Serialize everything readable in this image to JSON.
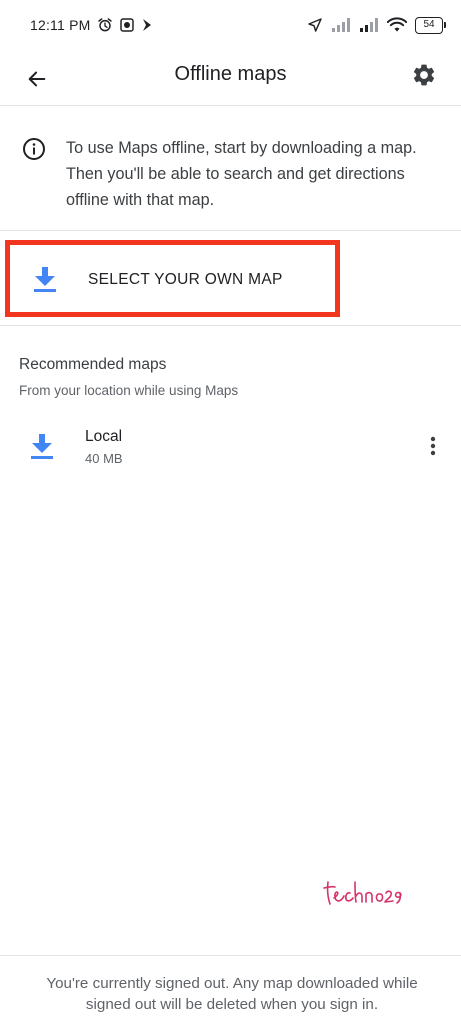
{
  "status_bar": {
    "time": "12:11 PM",
    "battery": "54"
  },
  "toolbar": {
    "title": "Offline maps"
  },
  "info": {
    "text": "To use Maps offline, start by downloading a map. Then you'll be able to search and get directions offline with that map."
  },
  "select_map": {
    "label": "SELECT YOUR OWN MAP"
  },
  "recommended": {
    "title": "Recommended maps",
    "subtitle": "From your location while using Maps",
    "items": [
      {
        "name": "Local",
        "size": "40 MB"
      }
    ]
  },
  "watermark": {
    "text": "techno29"
  },
  "footer": {
    "text": "You're currently signed out. Any map downloaded while signed out will be deleted when you sign in."
  },
  "colors": {
    "accent_blue": "#4285f4",
    "highlight_red": "#f2351f",
    "watermark_pink": "#d6336c"
  },
  "icons": [
    "back-arrow-icon",
    "settings-gear-icon",
    "info-icon",
    "download-icon",
    "more-vert-icon",
    "alarm-icon",
    "location-arrow-icon",
    "wifi-icon",
    "signal-icon"
  ]
}
